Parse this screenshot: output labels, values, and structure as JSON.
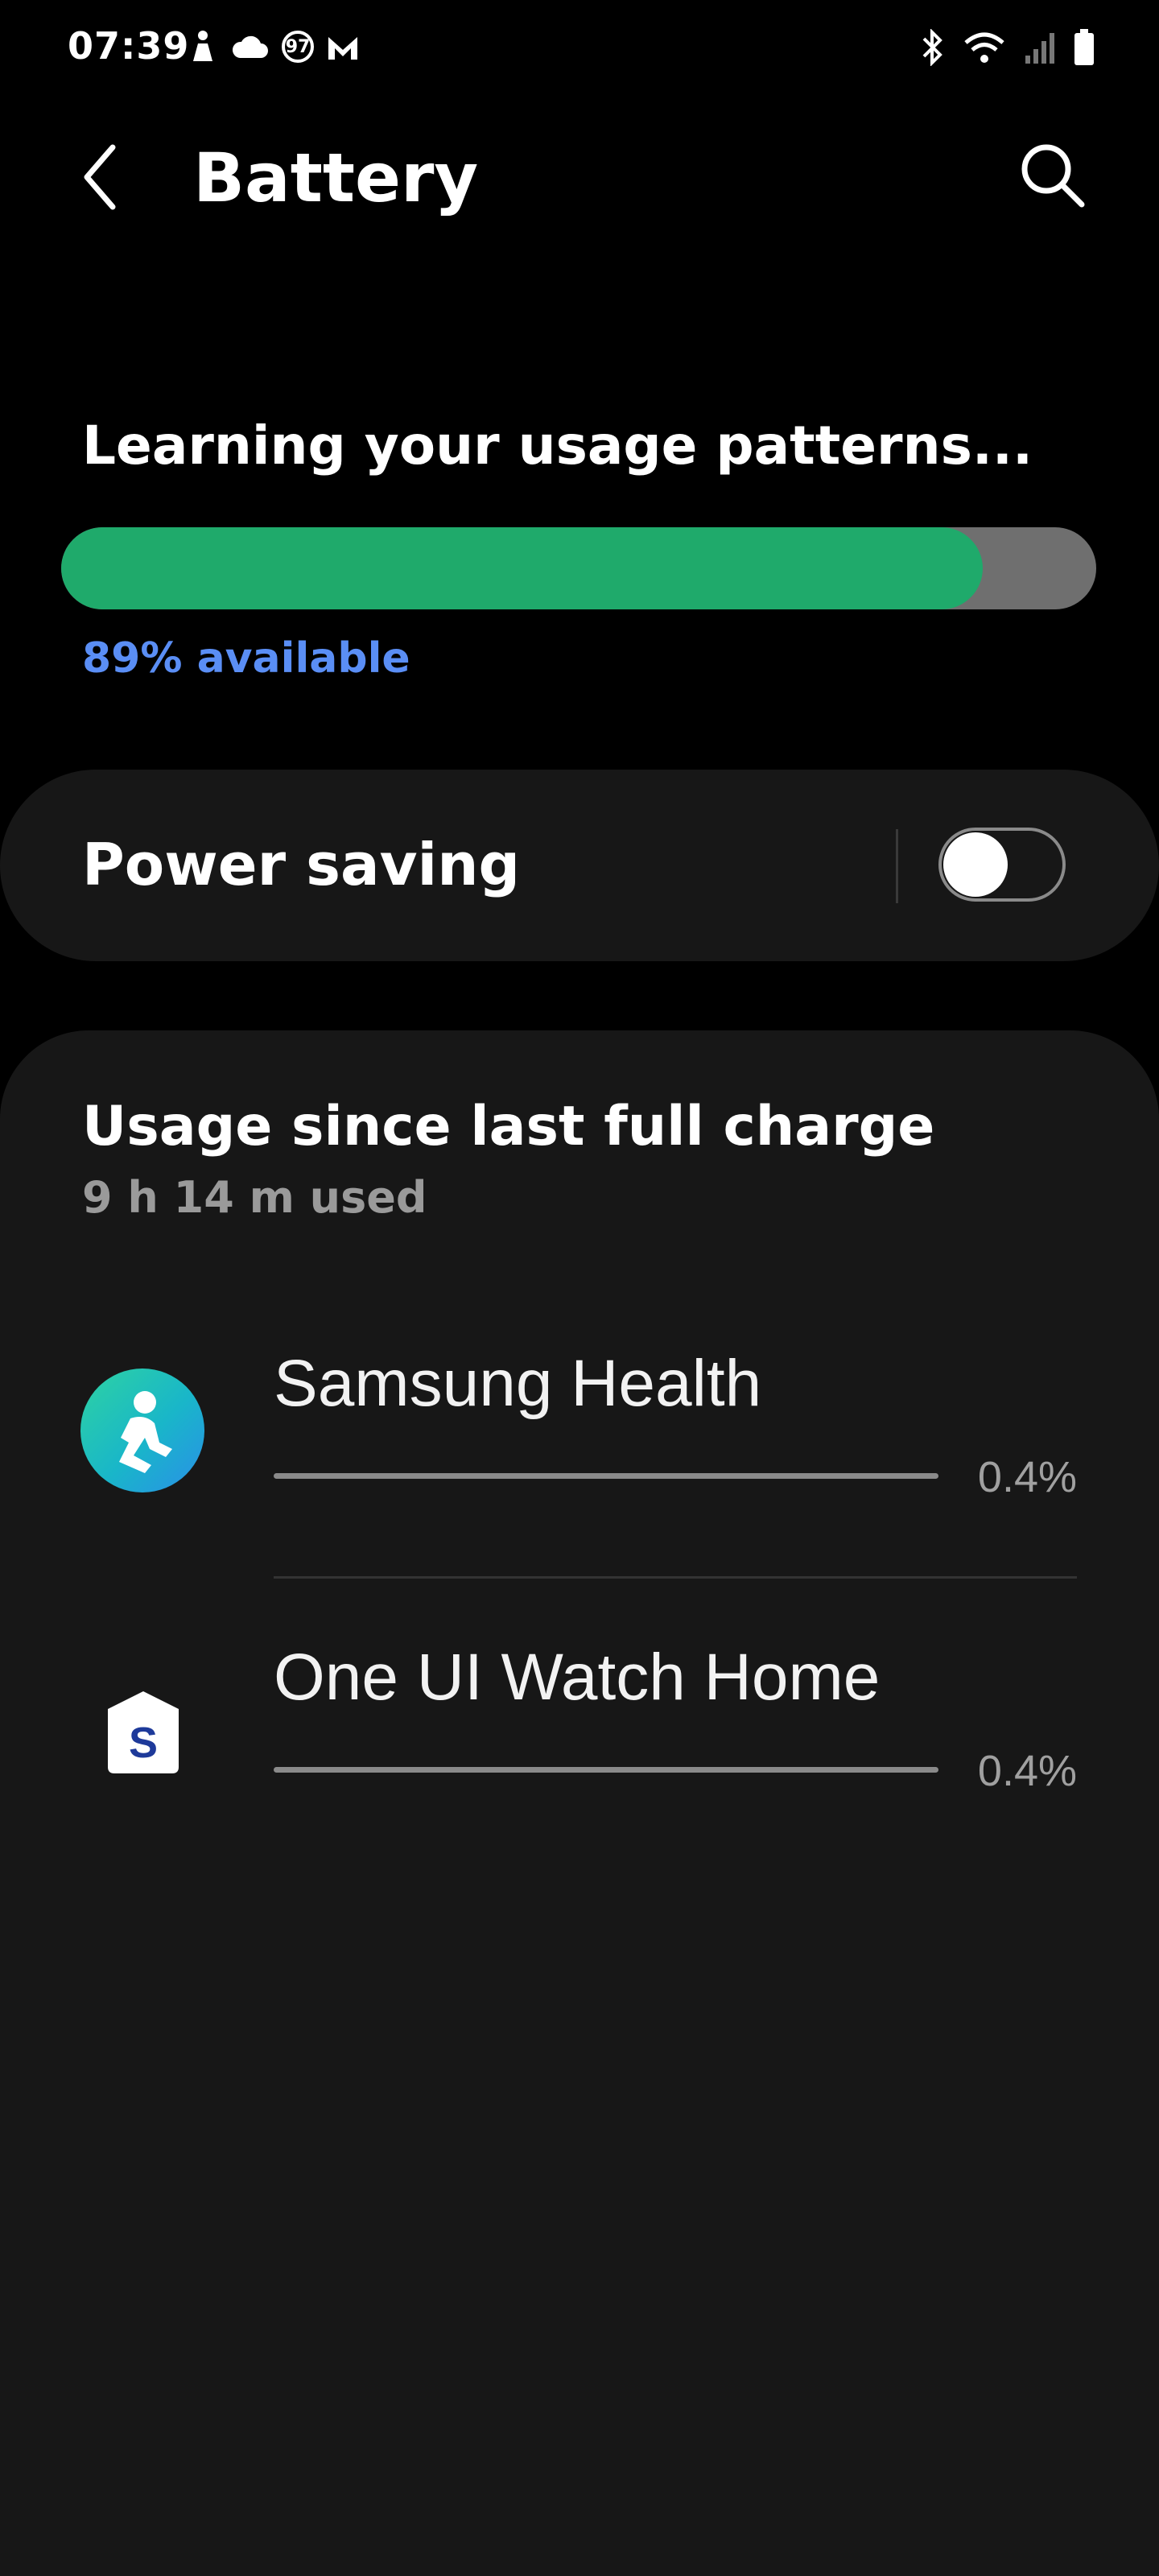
{
  "status_bar": {
    "time": "07:39",
    "notif_badge": "97"
  },
  "header": {
    "title": "Battery"
  },
  "battery": {
    "status_text": "Learning your usage patterns...",
    "level_percent": 89,
    "available_text": "89% available",
    "bar_color": "#1faa6b"
  },
  "power_saving": {
    "label": "Power saving",
    "enabled": false
  },
  "usage": {
    "title": "Usage since last full charge",
    "subtitle": "9 h 14 m used",
    "apps": [
      {
        "name": "Samsung Health",
        "percent": "0.4%",
        "icon": "samsung-health-icon"
      },
      {
        "name": "One UI Watch Home",
        "percent": "0.4%",
        "icon": "one-ui-watch-home-icon"
      }
    ]
  }
}
